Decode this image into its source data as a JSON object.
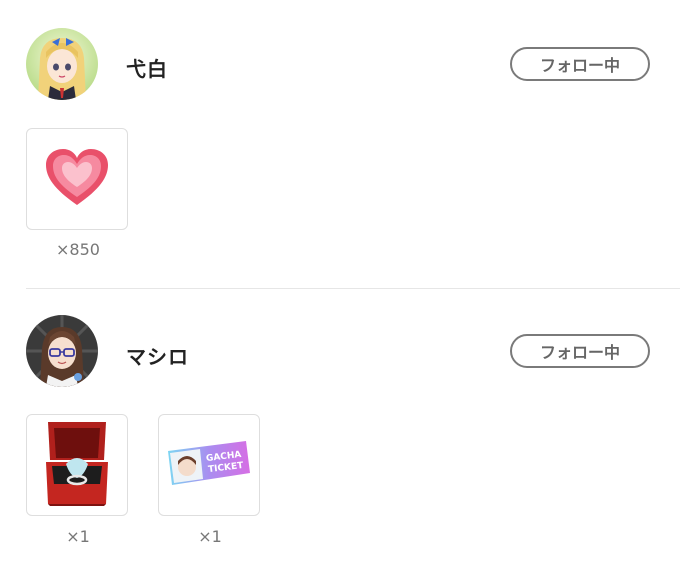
{
  "users": [
    {
      "name": "弋白",
      "follow_label": "フォロー中",
      "gifts": [
        {
          "icon": "heart-icon",
          "count": "×850"
        }
      ]
    },
    {
      "name": "マシロ",
      "follow_label": "フォロー中",
      "gifts": [
        {
          "icon": "ring-box-icon",
          "count": "×1"
        },
        {
          "icon": "gacha-ticket-icon",
          "count": "×1",
          "ticket_text_1": "GACHA",
          "ticket_text_2": "TICKET"
        }
      ]
    }
  ]
}
